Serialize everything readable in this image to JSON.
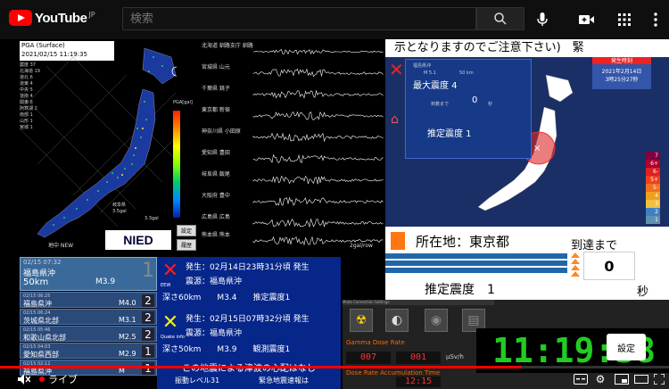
{
  "header": {
    "logo_text": "YouTube",
    "logo_region": "JP",
    "search_placeholder": "検索"
  },
  "map": {
    "pga_title": "PGA (Surface)",
    "pga_time": "2021/02/15 11:19:35",
    "stats": [
      "震度 37",
      "北海道 19",
      "道北 6",
      "道東 4",
      "中央 5",
      "道南 4",
      "関東 6",
      "阿寒湖 2",
      "南部 1",
      "山形 1",
      "宮城 1"
    ],
    "scale_title": "PGA[gal]",
    "scale_value": "3.3gal",
    "kushiro_label": "岐阜県",
    "kushiro_value": "3.5gal",
    "map_label": "地中 NEW",
    "nied": "NIED",
    "btn_settings": "設定",
    "btn_history": "履歴"
  },
  "waves": {
    "stations": [
      "北海道 釧路支庁 釧路",
      "宮城県 山元",
      "千葉県 銚子",
      "東京都 新宿",
      "神奈川県 小田原",
      "愛知県 豊田",
      "岐阜県 飯尾",
      "大阪府 豊中",
      "広島県 広島",
      "熊本県 熊本"
    ],
    "gal_label": "2gal/row"
  },
  "alert": {
    "banner": "示となりますのでご注意下さい)　緊",
    "region": "福島県沖",
    "depth": "50 km",
    "magnitude": "M 5.1",
    "max_label": "最大震度 4",
    "arrive_label": "到着まで",
    "arrive_value": "0",
    "arrive_unit": "秒",
    "est_label": "推定震度 1",
    "date_hdr": "発生時刻",
    "date": "2021年2月14日",
    "time": "3時25分27秒",
    "int_levels": [
      "7",
      "6+",
      "6-",
      "5+",
      "5-",
      "4",
      "3",
      "2",
      "1"
    ]
  },
  "location": {
    "name": "所在地：東京都",
    "intensity": "推定震度　1",
    "arrive_label": "到達まで",
    "arrive_value": "0",
    "sec_label": "秒"
  },
  "eq_list": {
    "top": {
      "date": "02/15 07:32",
      "place": "福島県沖",
      "depth": "50km",
      "mag": "M3.9",
      "int": "1"
    },
    "rows": [
      {
        "date": "02/15 06:25",
        "place": "福島県沖",
        "mag": "M4.0",
        "int": "2"
      },
      {
        "date": "02/15 06:24",
        "place": "茨城県北部",
        "mag": "M3.1",
        "int": "2"
      },
      {
        "date": "02/15 05:46",
        "place": "和歌山県北部",
        "mag": "M2.5",
        "int": "2"
      },
      {
        "date": "02/15 04:03",
        "place": "愛知県西部",
        "mag": "M2.9",
        "int": "1"
      },
      {
        "date": "02/15 02:12",
        "place": "福島県沖",
        "mag": "M",
        "int": "1"
      }
    ]
  },
  "eew": {
    "block1": {
      "tag": "EEW",
      "line1": "発生：02月14日23時31分頃 発生",
      "line2": "震源：福島県沖",
      "line3": "深さ60km　　M3.4　　推定震度1"
    },
    "block2": {
      "tag": "Quake info",
      "line1": "発生：02月15日07時32分頃 発生",
      "line2": "震源：福島県沖",
      "line3": "深さ50km　　M3.9　　観測震度1"
    },
    "footer": "この地震による津波の心配はなし",
    "level": "振動レベル31",
    "warning": "緊急地震速報は"
  },
  "gamma": {
    "tabs": "Mode  Connection  Settings",
    "dose_rate": "Gamma Dose Rate",
    "dose_acc": "Dose Rate Accumulation Time",
    "digits1": "007",
    "digits2": "001",
    "digits3": "12:15",
    "unit": "μSv/h"
  },
  "clock": "11:19:38",
  "settings_popup": "設定",
  "player": {
    "live": "ライブ",
    "progress": 0.78
  }
}
